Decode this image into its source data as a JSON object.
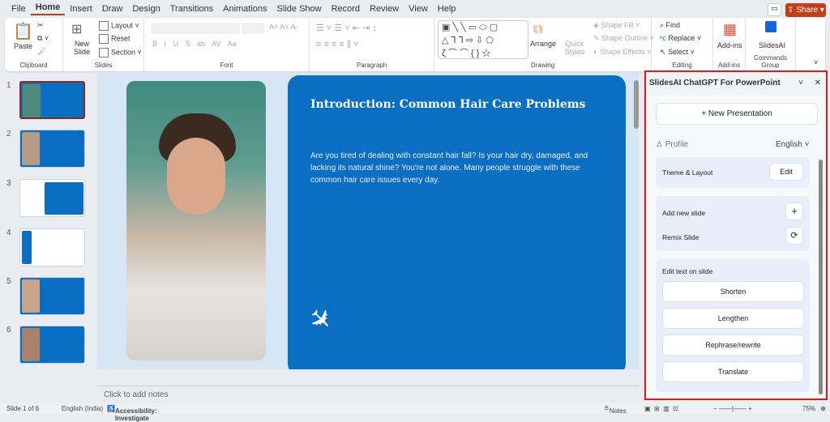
{
  "menu": {
    "tabs": [
      "File",
      "Home",
      "Insert",
      "Draw",
      "Design",
      "Transitions",
      "Animations",
      "Slide Show",
      "Record",
      "Review",
      "View",
      "Help"
    ],
    "active": "Home",
    "share": "Share"
  },
  "ribbon": {
    "clipboard": {
      "paste": "Paste",
      "label": "Clipboard"
    },
    "slides": {
      "new_slide": "New Slide",
      "layout": "Layout",
      "reset": "Reset",
      "section": "Section",
      "label": "Slides"
    },
    "font": {
      "label": "Font",
      "buttons": [
        "B",
        "I",
        "U",
        "S",
        "ab",
        "AV",
        "Aa"
      ]
    },
    "paragraph": {
      "label": "Paragraph"
    },
    "drawing": {
      "arrange": "Arrange",
      "quick_styles": "Quick Styles",
      "shape_fill": "Shape Fill",
      "shape_outline": "Shape Outline",
      "shape_effects": "Shape Effects",
      "label": "Drawing"
    },
    "editing": {
      "find": "Find",
      "replace": "Replace",
      "select": "Select",
      "label": "Editing"
    },
    "addins": {
      "addins": "Add-ins",
      "label": "Add-ins"
    },
    "commands": {
      "slidesai": "SlidesAI",
      "label": "Commands Group"
    }
  },
  "thumbnails": [
    "1",
    "2",
    "3",
    "4",
    "5",
    "6"
  ],
  "slide": {
    "title": "Introduction: Common Hair Care Problems",
    "body": "Are you tired of dealing with constant hair fall? Is your hair dry, damaged, and lacking its natural shine? You're not alone. Many people struggle with these common hair care issues every day."
  },
  "notes_placeholder": "Click to add notes",
  "panel": {
    "title": "SlidesAI ChatGPT For PowerPoint",
    "new_presentation": "New Presentation",
    "profile": "Profile",
    "language": "English",
    "theme_layout": "Theme & Layout",
    "edit": "Edit",
    "add_new_slide": "Add new slide",
    "remix_slide": "Remix Slide",
    "edit_text": "Edit text on slide",
    "actions": [
      "Shorten",
      "Lengthen",
      "Rephrase/rewrite",
      "Translate"
    ]
  },
  "status": {
    "slide": "Slide 1 of 6",
    "language": "English (India)",
    "accessibility": "Accessibility: Investigate",
    "notes": "Notes",
    "zoom": "75%"
  },
  "colors": {
    "accent": "#c43e1c",
    "slide_blue": "#0a6fc2",
    "highlight": "#e0191b"
  }
}
